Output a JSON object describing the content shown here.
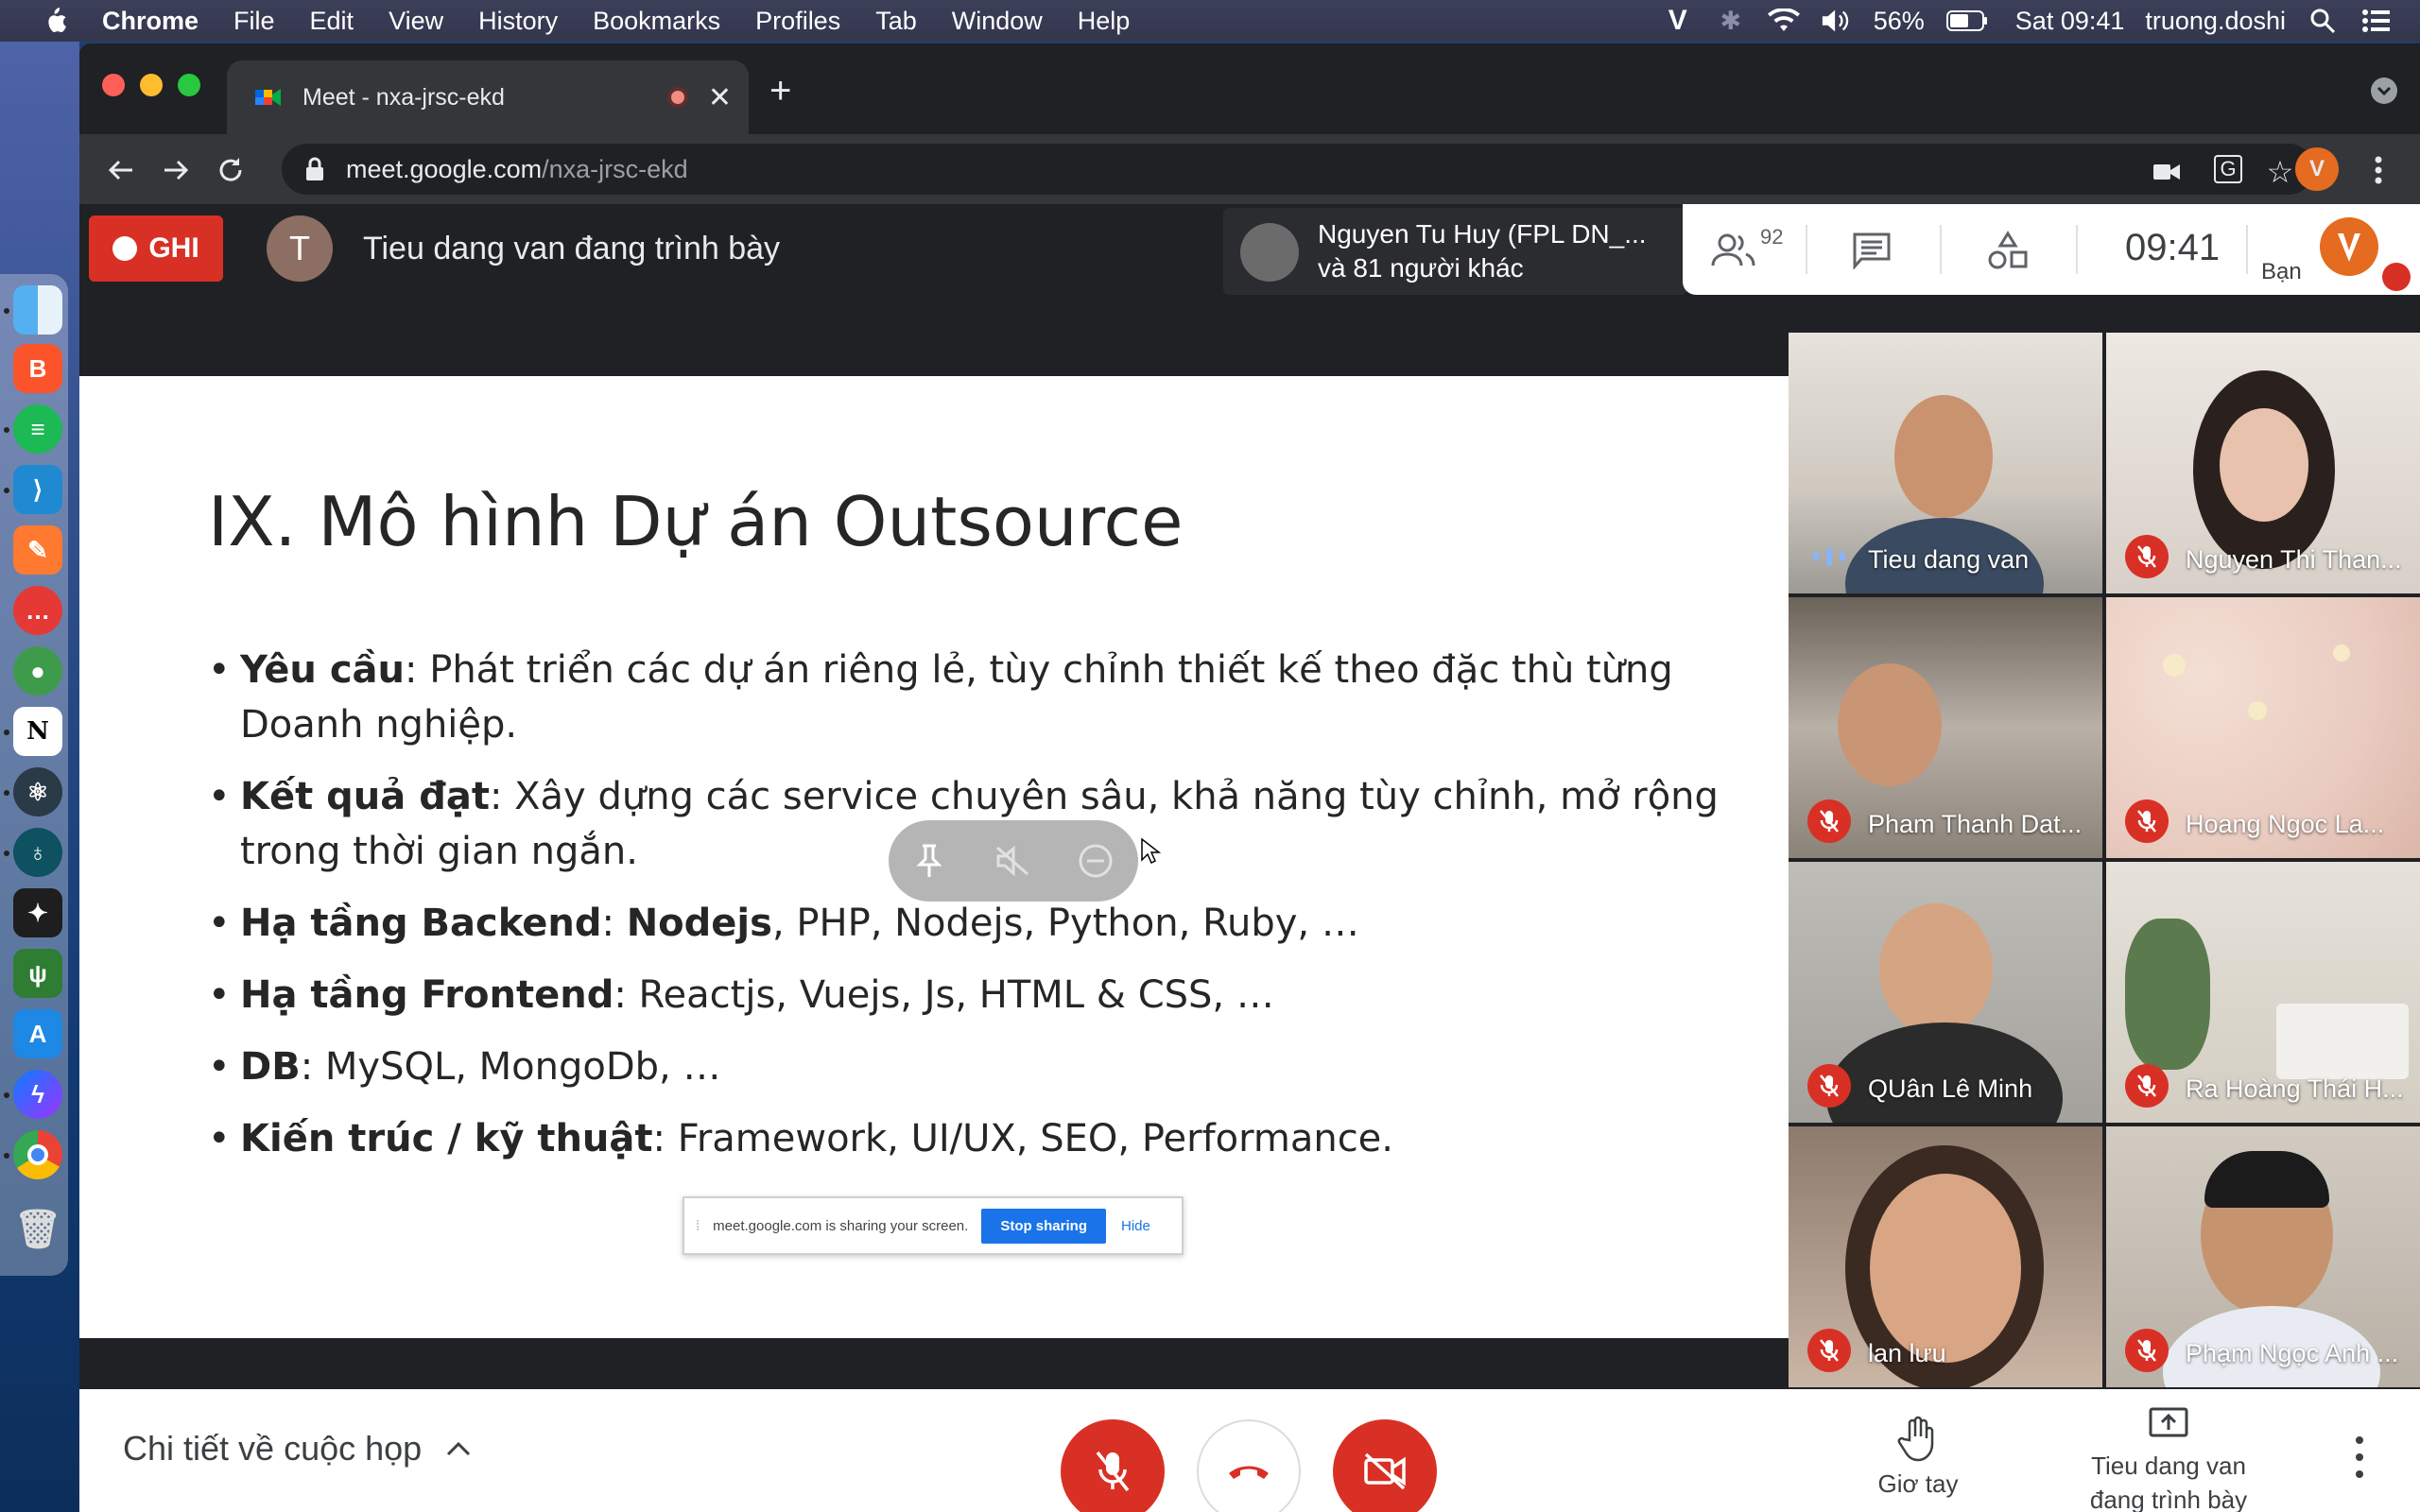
{
  "menubar": {
    "app": "Chrome",
    "items": [
      "File",
      "Edit",
      "View",
      "History",
      "Bookmarks",
      "Profiles",
      "Tab",
      "Window",
      "Help"
    ],
    "battery": "56%",
    "clock": "Sat 09:41",
    "user": "truong.doshi"
  },
  "browser": {
    "tab_title": "Meet - nxa-jrsc-ekd",
    "url_host": "meet.google.com",
    "url_path": "/nxa-jrsc-ekd"
  },
  "meet": {
    "recording_label": "GHI",
    "presenter_initial": "T",
    "presenter_text": "Tieu dang van đang trình bày",
    "participants_line1": "Nguyen Tu Huy (FPL DN_...",
    "participants_line2": "và 81 người khác",
    "participant_count": "92",
    "time": "09:41",
    "you_label": "Bạn"
  },
  "slide": {
    "title": "IX. Mô hình Dự án Outsource",
    "bullets": [
      {
        "bold": "Yêu cầu",
        "rest": ": Phát triển các dự án riêng lẻ, tùy chỉnh thiết kế theo đặc thù từng Doanh nghiệp."
      },
      {
        "bold": "Kết quả đạt",
        "rest": ": Xây dựng các service chuyên sâu, khả năng tùy chỉnh, mở rộng trong thời gian ngắn."
      },
      {
        "bold": "Hạ tầng Backend",
        "rest": ": ",
        "bold2": "Nodejs",
        "rest2": ", PHP, Nodejs, Python, Ruby, …"
      },
      {
        "bold": "Hạ tầng Frontend",
        "rest": ": Reactjs, Vuejs, Js, HTML & CSS, …"
      },
      {
        "bold": "DB",
        "rest": ": MySQL, MongoDb, …"
      },
      {
        "bold": "Kiến trúc / kỹ thuật",
        "rest": ": Framework, UI/UX, SEO, Performance."
      }
    ],
    "share_notice": "meet.google.com is sharing your screen.",
    "stop_sharing": "Stop sharing",
    "hide": "Hide"
  },
  "tiles": [
    {
      "name": "Tieu dang van",
      "status": "speaking"
    },
    {
      "name": "Nguyen Thi Than...",
      "status": "muted"
    },
    {
      "name": "Pham Thanh Dat...",
      "status": "muted"
    },
    {
      "name": "Hoang Ngoc La...",
      "status": "muted"
    },
    {
      "name": "QUân Lê Minh",
      "status": "muted"
    },
    {
      "name": "Ra Hoàng Thái H...",
      "status": "muted"
    },
    {
      "name": "lan lưu",
      "status": "muted"
    },
    {
      "name": "Phạm Ngọc Anh ...",
      "status": "muted"
    }
  ],
  "bottombar": {
    "meeting_details": "Chi tiết về cuộc họp",
    "raise_hand": "Giơ tay",
    "present_line1": "Tieu dang van",
    "present_line2": "đang trình bày"
  },
  "colors": {
    "red": "#d93025",
    "chrome_dark": "#202124",
    "blue": "#1a73e8"
  }
}
